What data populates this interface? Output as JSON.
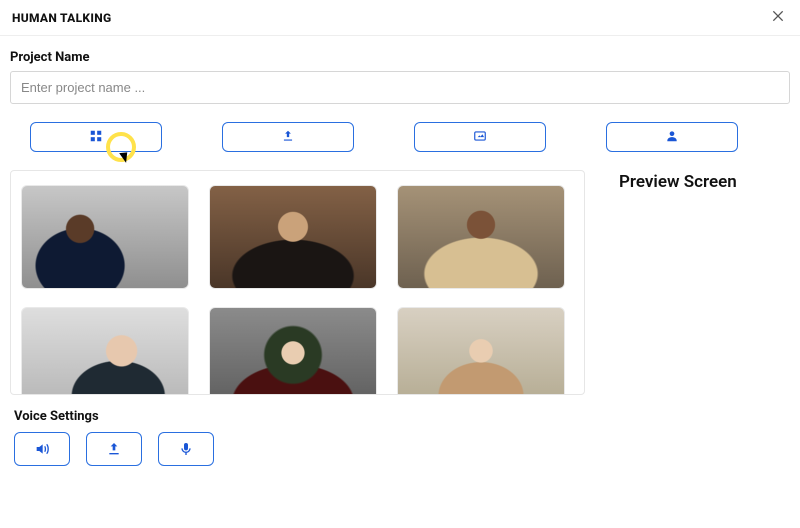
{
  "header": {
    "title": "HUMAN TALKING",
    "close_label": "Close"
  },
  "project": {
    "label": "Project Name",
    "placeholder": "Enter project name ...",
    "value": ""
  },
  "tabs": [
    {
      "name": "templates",
      "icon": "grid-icon"
    },
    {
      "name": "upload",
      "icon": "upload-icon"
    },
    {
      "name": "media",
      "icon": "media-icon"
    },
    {
      "name": "avatar",
      "icon": "person-icon"
    }
  ],
  "gallery": {
    "items": [
      {
        "name": "template-1"
      },
      {
        "name": "template-2"
      },
      {
        "name": "template-3"
      },
      {
        "name": "template-4"
      },
      {
        "name": "template-5"
      },
      {
        "name": "template-6"
      }
    ]
  },
  "preview": {
    "title": "Preview Screen"
  },
  "voice": {
    "label": "Voice Settings",
    "buttons": [
      {
        "name": "audio",
        "icon": "speaker-icon"
      },
      {
        "name": "upload",
        "icon": "upload-icon"
      },
      {
        "name": "record",
        "icon": "mic-icon"
      }
    ]
  },
  "colors": {
    "accent": "#1a56d6",
    "border": "#2a6fe0"
  }
}
